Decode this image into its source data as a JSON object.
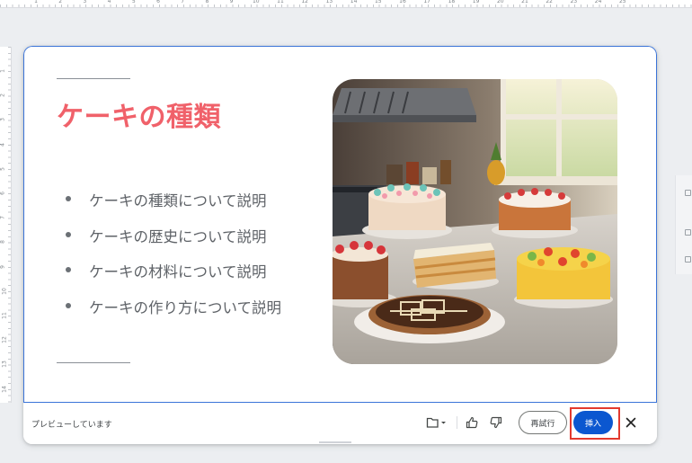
{
  "ruler": {
    "horizontal_numbers": [
      "1",
      "2",
      "3",
      "4",
      "5",
      "6",
      "7",
      "8",
      "9",
      "10",
      "11",
      "12",
      "13",
      "14",
      "15",
      "16",
      "17",
      "18",
      "19",
      "20",
      "21",
      "22",
      "23",
      "24",
      "25"
    ],
    "vertical_numbers": [
      "1",
      "2",
      "3",
      "4",
      "5",
      "6",
      "7",
      "8",
      "9",
      "10",
      "11",
      "12",
      "13",
      "14"
    ]
  },
  "slide": {
    "title": "ケーキの種類",
    "bullets": [
      "ケーキの種類について説明",
      "ケーキの歴史について説明",
      "ケーキの材料について説明",
      "ケーキの作り方について説明"
    ],
    "title_color": "#f0616a",
    "border_color": "#3b74d8"
  },
  "photo": {
    "subject": "cakes-on-kitchen-counter"
  },
  "action_bar": {
    "status": "プレビューしています",
    "retry_label": "再試行",
    "insert_label": "挿入",
    "icons": [
      "folder-icon",
      "caret-down-icon",
      "thumbs-up-icon",
      "thumbs-down-icon",
      "close-icon"
    ],
    "insert_color": "#0b57d0",
    "highlight_color": "#e33a2e"
  }
}
